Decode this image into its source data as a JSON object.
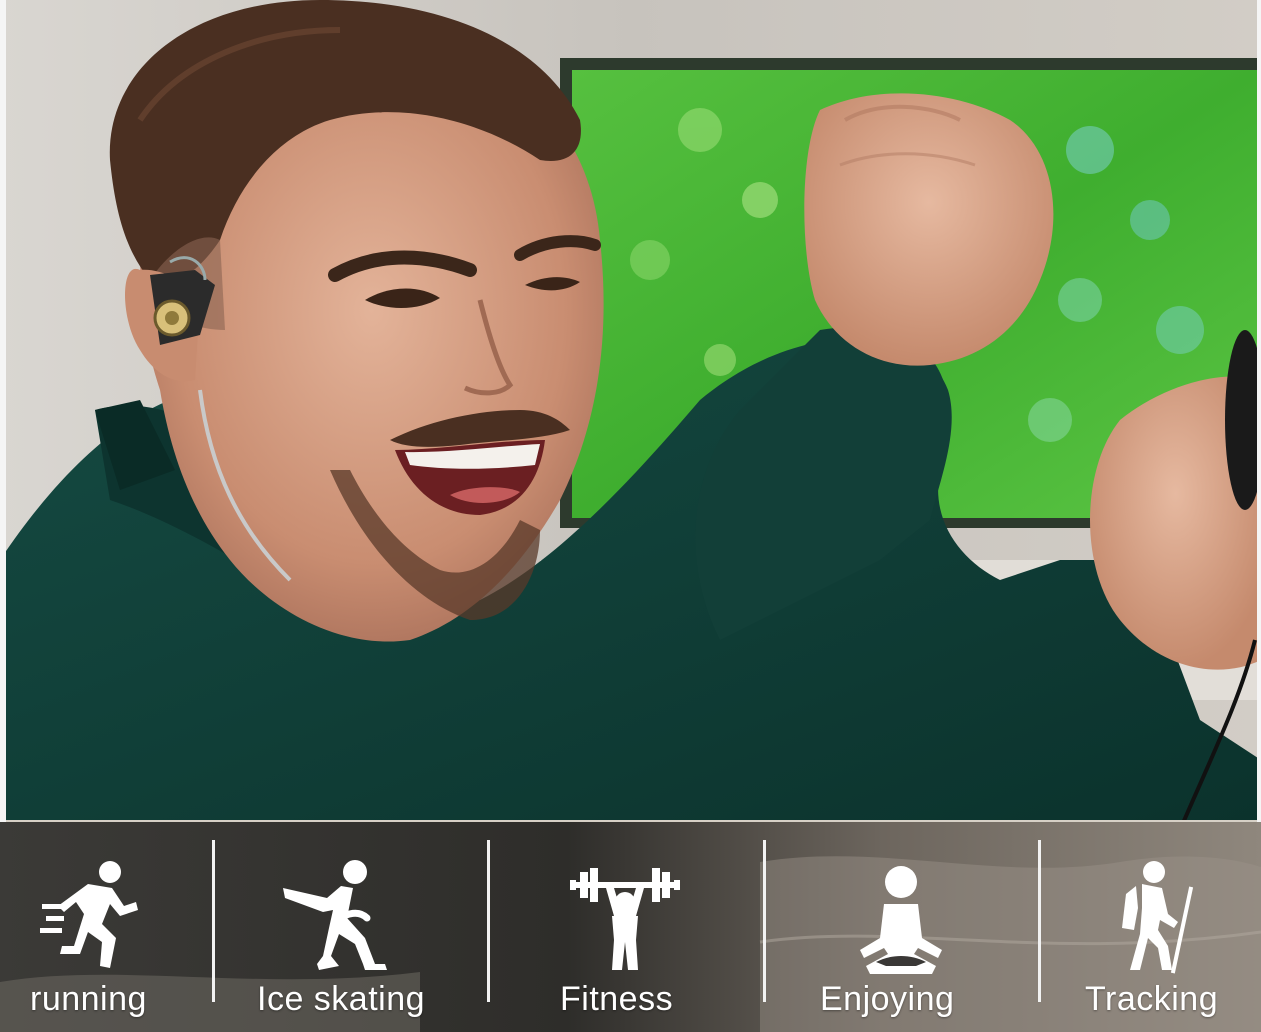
{
  "photo": {
    "subject": "man-with-earphones-cheering",
    "background": "tv-soccer-field"
  },
  "activities": [
    {
      "label": "running",
      "icon": "running-icon"
    },
    {
      "label": "Ice skating",
      "icon": "ice-skating-icon"
    },
    {
      "label": "Fitness",
      "icon": "weightlifting-icon"
    },
    {
      "label": "Enjoying",
      "icon": "meditation-icon"
    },
    {
      "label": "Tracking",
      "icon": "hiking-icon"
    }
  ],
  "colors": {
    "bar": "#3a3633",
    "sweater": "#0f3d36",
    "tv": "#4fb53a",
    "label": "#ffffff"
  }
}
